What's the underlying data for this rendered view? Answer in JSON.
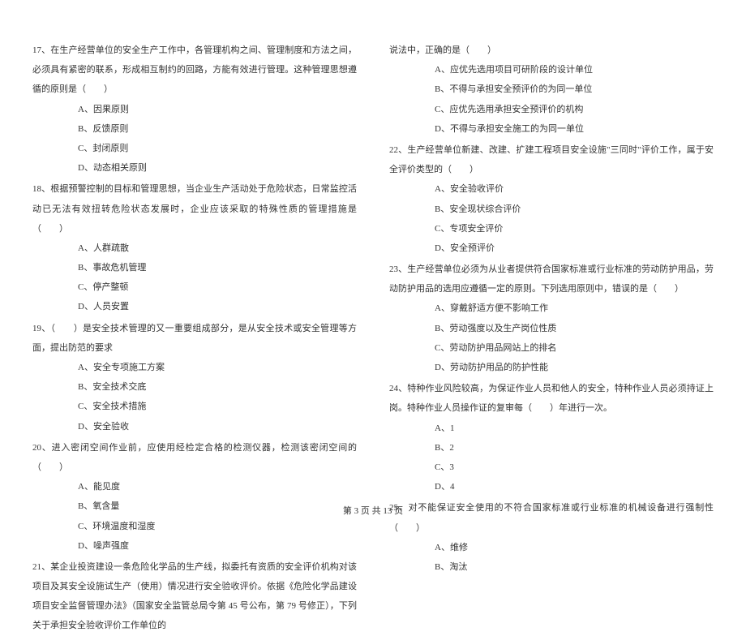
{
  "left": {
    "q17": {
      "stem": "17、在生产经营单位的安全生产工作中，各管理机构之间、管理制度和方法之间，必须具有紧密的联系，形成相互制约的回路，方能有效进行管理。这种管理思想遵循的原则是（　　）",
      "a": "A、因果原则",
      "b": "B、反馈原则",
      "c": "C、封闭原则",
      "d": "D、动态相关原则"
    },
    "q18": {
      "stem": "18、根据预警控制的目标和管理思想，当企业生产活动处于危险状态，日常监控活动已无法有效扭转危险状态发展时，企业应该采取的特殊性质的管理措施是（　　）",
      "a": "A、人群疏散",
      "b": "B、事故危机管理",
      "c": "C、停产整顿",
      "d": "D、人员安置"
    },
    "q19": {
      "stem": "19、（　　）是安全技术管理的又一重要组成部分，是从安全技术或安全管理等方面，提出防范的要求",
      "a": "A、安全专项施工方案",
      "b": "B、安全技术交底",
      "c": "C、安全技术措施",
      "d": "D、安全验收"
    },
    "q20": {
      "stem": "20、进入密闭空间作业前，应使用经检定合格的检测仪器，检测该密闭空间的（　　）",
      "a": "A、能见度",
      "b": "B、氧含量",
      "c": "C、环境温度和湿度",
      "d": "D、噪声强度"
    },
    "q21": {
      "stem": "21、某企业投资建设一条危险化学品的生产线，拟委托有资质的安全评价机构对该项目及其安全设施试生产（使用）情况进行安全验收评价。依据《危险化学品建设项目安全监督管理办法》（国家安全监管总局令第 45 号公布，第 79 号修正），下列关于承担安全验收评价工作单位的"
    }
  },
  "right": {
    "q21cont": {
      "stem": "说法中，正确的是（　　）",
      "a": "A、应优先选用项目可研阶段的设计单位",
      "b": "B、不得与承担安全预评价的为同一单位",
      "c": "C、应优先选用承担安全预评价的机构",
      "d": "D、不得与承担安全施工的为同一单位"
    },
    "q22": {
      "stem": "22、生产经营单位新建、改建、扩建工程项目安全设施\"三同时\"评价工作，属于安全评价类型的（　　）",
      "a": "A、安全验收评价",
      "b": "B、安全现状综合评价",
      "c": "C、专项安全评价",
      "d": "D、安全预评价"
    },
    "q23": {
      "stem": "23、生产经营单位必须为从业者提供符合国家标准或行业标准的劳动防护用品，劳动防护用品的选用应遵循一定的原则。下列选用原则中，错误的是（　　）",
      "a": "A、穿戴舒适方便不影响工作",
      "b": "B、劳动强度以及生产岗位性质",
      "c": "C、劳动防护用品网站上的排名",
      "d": "D、劳动防护用品的防护性能"
    },
    "q24": {
      "stem": "24、特种作业风险较高，为保证作业人员和他人的安全，特种作业人员必须持证上岗。特种作业人员操作证的复审每（　　）年进行一次。",
      "a": "A、1",
      "b": "B、2",
      "c": "C、3",
      "d": "D、4"
    },
    "q25": {
      "stem": "25、对不能保证安全使用的不符合国家标准或行业标准的机械设备进行强制性（　　）",
      "a": "A、维修",
      "b": "B、淘汰"
    }
  },
  "footer": "第 3 页 共 13 页"
}
